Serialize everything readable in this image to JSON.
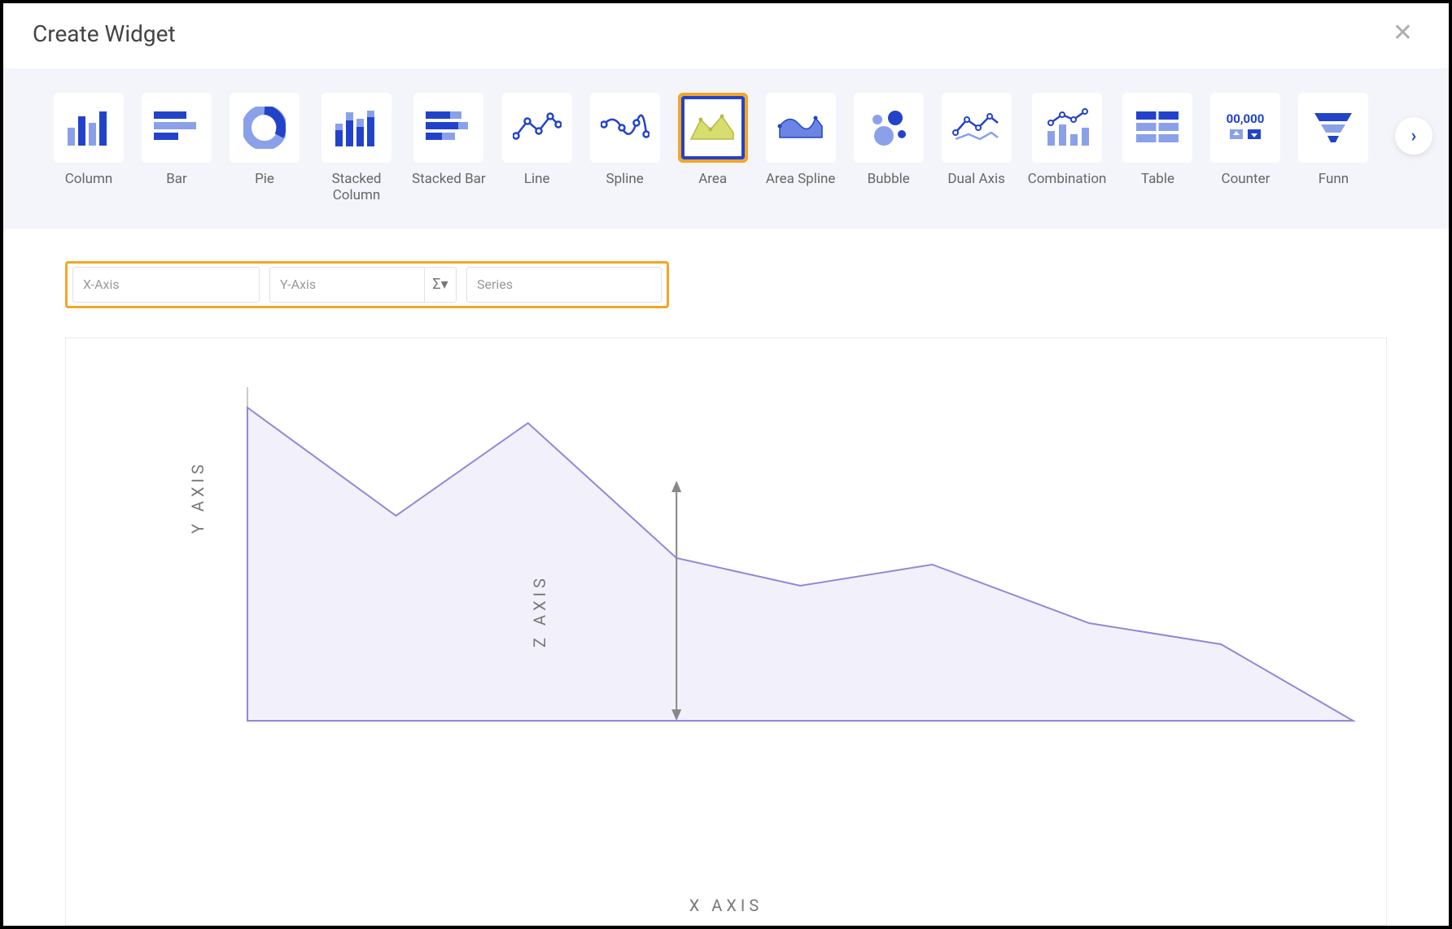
{
  "dialog": {
    "title": "Create Widget"
  },
  "chartTypes": [
    {
      "id": "column",
      "label": "Column"
    },
    {
      "id": "bar",
      "label": "Bar"
    },
    {
      "id": "pie",
      "label": "Pie"
    },
    {
      "id": "stacked-column",
      "label": "Stacked Column"
    },
    {
      "id": "stacked-bar",
      "label": "Stacked Bar"
    },
    {
      "id": "line",
      "label": "Line"
    },
    {
      "id": "spline",
      "label": "Spline"
    },
    {
      "id": "area",
      "label": "Area",
      "selected": true
    },
    {
      "id": "area-spline",
      "label": "Area Spline"
    },
    {
      "id": "bubble",
      "label": "Bubble"
    },
    {
      "id": "dual-axis",
      "label": "Dual Axis"
    },
    {
      "id": "combination",
      "label": "Combination"
    },
    {
      "id": "table",
      "label": "Table"
    },
    {
      "id": "counter",
      "label": "Counter"
    },
    {
      "id": "funnel",
      "label": "Funn"
    }
  ],
  "axisConfig": {
    "x_placeholder": "X-Axis",
    "y_placeholder": "Y-Axis",
    "sigma_label": "Σ▾",
    "series_placeholder": "Series"
  },
  "preview": {
    "y_label": "Y AXIS",
    "x_label": "X AXIS",
    "z_label": "Z AXIS"
  },
  "chart_data": {
    "type": "area",
    "title": "",
    "xlabel": "X AXIS",
    "ylabel": "Y AXIS",
    "x": [
      0,
      1,
      2,
      3,
      4,
      5,
      6,
      7,
      8
    ],
    "values": [
      92,
      58,
      86,
      49,
      38,
      45,
      27,
      20,
      0
    ],
    "ylim": [
      0,
      100
    ]
  }
}
